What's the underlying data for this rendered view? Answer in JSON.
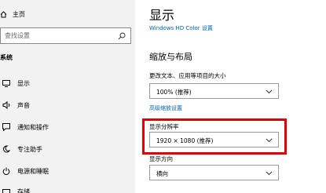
{
  "sidebar": {
    "home_label": "主页",
    "search_placeholder": "查找设置",
    "section_label": "系统",
    "items": [
      {
        "label": "显示",
        "icon": "monitor-icon"
      },
      {
        "label": "声音",
        "icon": "speaker-icon"
      },
      {
        "label": "通知和操作",
        "icon": "notification-icon"
      },
      {
        "label": "专注助手",
        "icon": "moon-icon"
      },
      {
        "label": "电源和睡眠",
        "icon": "power-icon"
      },
      {
        "label": "存储",
        "icon": "storage-icon"
      }
    ]
  },
  "main": {
    "title": "显示",
    "hd_color_link": "Windows HD Color 设置",
    "scale_heading": "缩放与布局",
    "text_size_label": "更改文本、应用等项目的大小",
    "text_size_value": "100% (推荐)",
    "advanced_scaling_link": "高级缩放设置",
    "resolution_label": "显示分辨率",
    "resolution_value": "1920 × 1080 (推荐)",
    "orientation_label": "显示方向",
    "orientation_value": "横向"
  },
  "colors": {
    "link": "#0063b1",
    "highlight": "#e00000",
    "sidebar_bg": "#f2f2f2"
  }
}
